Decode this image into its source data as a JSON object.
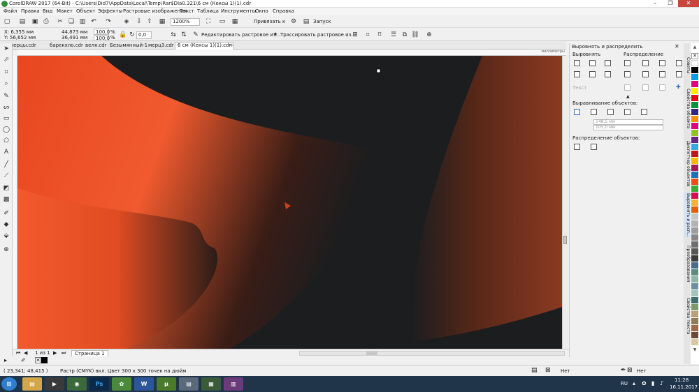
{
  "window": {
    "title": "CorelDRAW 2017 (64-Bit) - C:\\Users\\Did7\\AppData\\Local\\Temp\\Rar$DIa0.321\\6 см (Кексы 1)(1).cdr",
    "min": "–",
    "max": "❐",
    "close": "✕"
  },
  "menu": [
    "Файл",
    "Правка",
    "Вид",
    "Макет",
    "Объект",
    "Эффекты",
    "Растровые изображения",
    "Текст",
    "Таблица",
    "Инструменты",
    "Окно",
    "Справка"
  ],
  "toolbar": {
    "zoom": "1200%",
    "snap_label": "Привязать к",
    "launch_label": "Запуск"
  },
  "propbar": {
    "x": "X: 6,355 мм",
    "y": "Y: 56,652 мм",
    "w": "44,873 мм",
    "h": "36,491 мм",
    "scale_w": "100,0",
    "scale_h": "100,0",
    "pct": "%",
    "angle": "0,0",
    "edit_bitmap": "Редактировать растровое из...",
    "trace_bitmap": "Трассировать растровое из..."
  },
  "tabs": [
    "мерцы.cdr",
    "барекхло.cdr",
    "веля.cdr",
    "Безымянный-1",
    "мерц3.cdr",
    "6 см (Кексы 1)(1).cdr"
  ],
  "ruler_units": "миллиметры",
  "pagenav": {
    "page_of": "1 из 1",
    "page_tab": "Страница 1"
  },
  "status": {
    "coords": "( 23,341; 48,415 )",
    "info": "Растр (CMYK) вкл. Цвет 300 x 300 точек на дюйм",
    "fill": "Нет",
    "outline": "Нет"
  },
  "docker": {
    "title": "Выровнять и распределить",
    "align": "Выровнять",
    "distribute": "Распределение",
    "text": "Текст",
    "align_objects": "Выравнивание объектов:",
    "coord_x": "148,5 мм",
    "coord_y": "105,0 мм",
    "distribute_objects": "Распределение объектов:"
  },
  "side_tabs": [
    "Советы",
    "Свойства объекта",
    "Диспетчер объектов",
    "Выровнять и расп...",
    "Преобразования",
    "Свойства текста"
  ],
  "taskbar": {
    "lang": "RU",
    "time": "11:28",
    "date": "16.11.2017"
  },
  "colors": {
    "orange": "#f0522a",
    "dark": "#1c1d1f",
    "brown": "#7a3220"
  }
}
